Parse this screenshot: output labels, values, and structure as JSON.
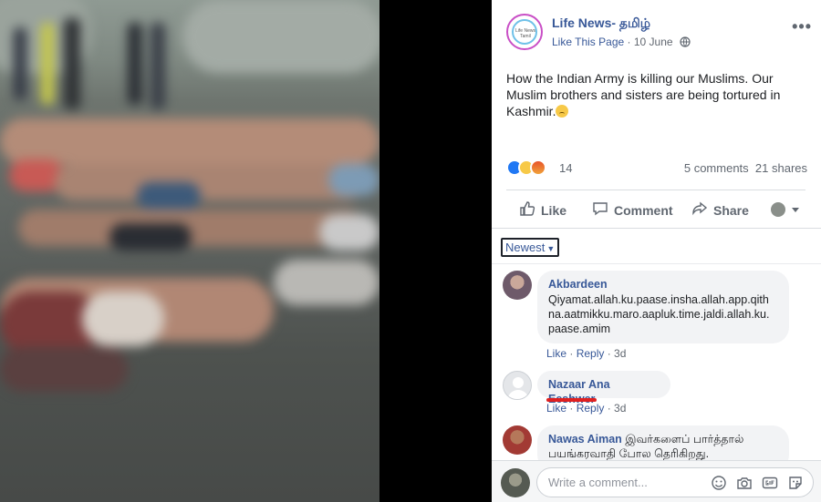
{
  "post": {
    "page_name": "Life News- தமிழ்",
    "like_page": "Like This Page",
    "separator": "·",
    "date": "10 June",
    "more": "•••",
    "text": "How the Indian Army is killing our Muslims. Our Muslim brothers and sisters are being tortured in Kashmir.",
    "logo_text": "Life News Tamil"
  },
  "reactions": {
    "count": "14",
    "comments": "5 comments",
    "shares": "21 shares"
  },
  "actions": {
    "like": "Like",
    "comment": "Comment",
    "share": "Share"
  },
  "sort": {
    "label": "Newest"
  },
  "comments": [
    {
      "name": "Akbardeen",
      "text": "Qiyamat.allah.ku.paase.insha.allah.app.qith na.aatmikku.maro.aapluk.time.jaldi.allah.ku. paase.amim",
      "like": "Like",
      "reply": "Reply",
      "time": "3d"
    },
    {
      "name": "Nazaar Ana",
      "redacted": "Eeshwer",
      "like": "Like",
      "reply": "Reply",
      "time": "3d"
    },
    {
      "name": "Nawas Aiman",
      "text": "இவர்களைப் பார்த்தால் பயங்கரவாதி போல தெரிகிறது."
    }
  ],
  "composer": {
    "placeholder": "Write a comment..."
  },
  "colors": {
    "link": "#385898",
    "bubble": "#f2f3f5",
    "like_blue": "#2078f4",
    "redact": "#e02020"
  }
}
